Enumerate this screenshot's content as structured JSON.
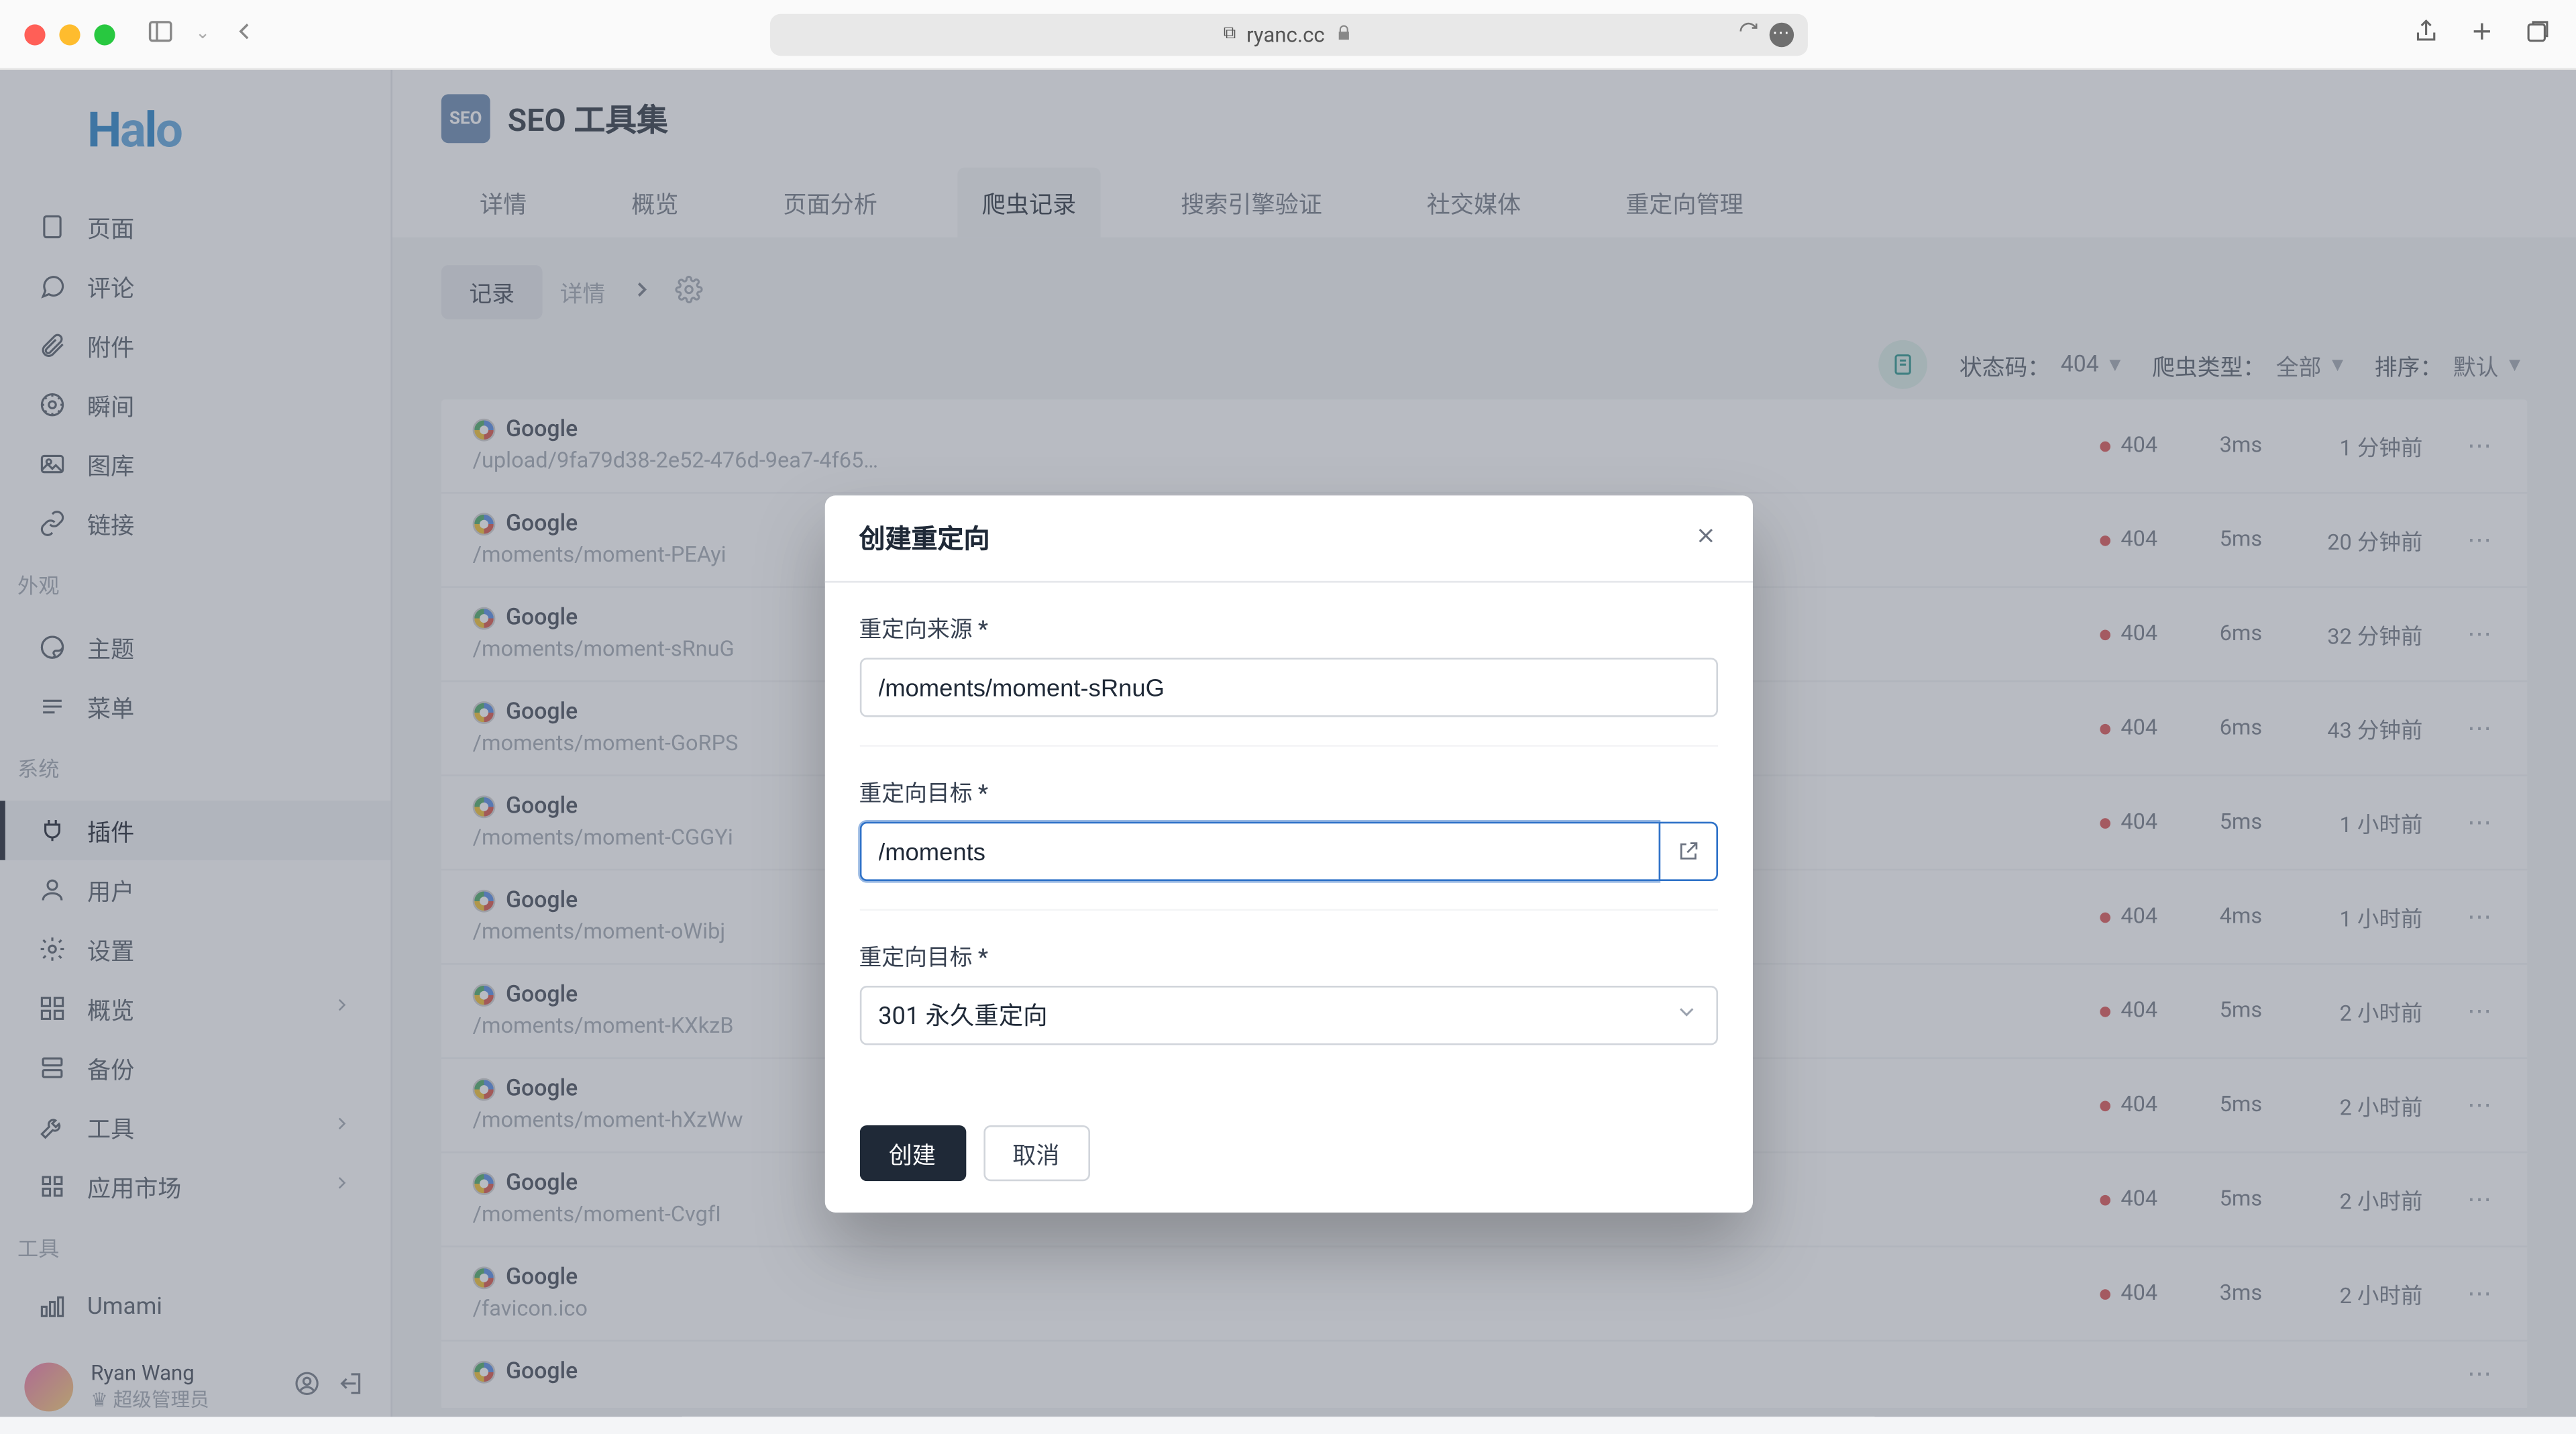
{
  "browser": {
    "url": "ryanc.cc"
  },
  "logo": "Halo",
  "sidebar": {
    "items_content": [
      {
        "icon": "page-icon",
        "label": "页面"
      },
      {
        "icon": "comment-icon",
        "label": "评论"
      },
      {
        "icon": "attachment-icon",
        "label": "附件"
      },
      {
        "icon": "moment-icon",
        "label": "瞬间"
      },
      {
        "icon": "gallery-icon",
        "label": "图库"
      },
      {
        "icon": "link-icon",
        "label": "链接"
      }
    ],
    "section_appearance": "外观",
    "items_appearance": [
      {
        "icon": "theme-icon",
        "label": "主题"
      },
      {
        "icon": "menu-icon",
        "label": "菜单"
      }
    ],
    "section_system": "系统",
    "items_system": [
      {
        "icon": "plugin-icon",
        "label": "插件",
        "active": true
      },
      {
        "icon": "user-icon",
        "label": "用户"
      },
      {
        "icon": "settings-icon",
        "label": "设置"
      },
      {
        "icon": "overview-icon",
        "label": "概览",
        "chevron": true
      },
      {
        "icon": "backup-icon",
        "label": "备份"
      },
      {
        "icon": "tool-icon",
        "label": "工具",
        "chevron": true
      },
      {
        "icon": "market-icon",
        "label": "应用市场",
        "chevron": true
      }
    ],
    "section_tools": "工具",
    "items_tools": [
      {
        "icon": "analytics-icon",
        "label": "Umami"
      }
    ],
    "user": {
      "name": "Ryan Wang",
      "role": "超级管理员"
    }
  },
  "page": {
    "badge": "SEO",
    "title": "SEO 工具集",
    "tabs": [
      "详情",
      "概览",
      "页面分析",
      "爬虫记录",
      "搜索引擎验证",
      "社交媒体",
      "重定向管理"
    ],
    "active_tab": 3,
    "subtabs": {
      "record": "记录",
      "detail": "详情"
    },
    "filters": {
      "status_label": "状态码：",
      "status_value": "404",
      "crawler_label": "爬虫类型：",
      "crawler_value": "全部",
      "sort_label": "排序：",
      "sort_value": "默认"
    }
  },
  "records": [
    {
      "crawler": "Google",
      "path": "/upload/9fa79d38-2e52-476d-9ea7-4f65…",
      "status": "404",
      "duration": "3ms",
      "time": "1 分钟前"
    },
    {
      "crawler": "Google",
      "path": "/moments/moment-PEAyi",
      "status": "404",
      "duration": "5ms",
      "time": "20 分钟前"
    },
    {
      "crawler": "Google",
      "path": "/moments/moment-sRnuG",
      "status": "404",
      "duration": "6ms",
      "time": "32 分钟前"
    },
    {
      "crawler": "Google",
      "path": "/moments/moment-GoRPS",
      "status": "404",
      "duration": "6ms",
      "time": "43 分钟前"
    },
    {
      "crawler": "Google",
      "path": "/moments/moment-CGGYi",
      "status": "404",
      "duration": "5ms",
      "time": "1 小时前"
    },
    {
      "crawler": "Google",
      "path": "/moments/moment-oWibj",
      "status": "404",
      "duration": "4ms",
      "time": "1 小时前"
    },
    {
      "crawler": "Google",
      "path": "/moments/moment-KXkzB",
      "status": "404",
      "duration": "5ms",
      "time": "2 小时前"
    },
    {
      "crawler": "Google",
      "path": "/moments/moment-hXzWw",
      "status": "404",
      "duration": "5ms",
      "time": "2 小时前"
    },
    {
      "crawler": "Google",
      "path": "/moments/moment-CvgfI",
      "status": "404",
      "duration": "5ms",
      "time": "2 小时前"
    },
    {
      "crawler": "Google",
      "path": "/favicon.ico",
      "status": "404",
      "duration": "3ms",
      "time": "2 小时前"
    },
    {
      "crawler": "Google",
      "path": "",
      "status": "",
      "duration": "",
      "time": ""
    }
  ],
  "modal": {
    "title": "创建重定向",
    "source_label": "重定向来源 *",
    "source_value": "/moments/moment-sRnuG",
    "target_label": "重定向目标 *",
    "target_value": "/moments",
    "type_label": "重定向目标 *",
    "type_value": "301 永久重定向",
    "submit": "创建",
    "cancel": "取消"
  }
}
